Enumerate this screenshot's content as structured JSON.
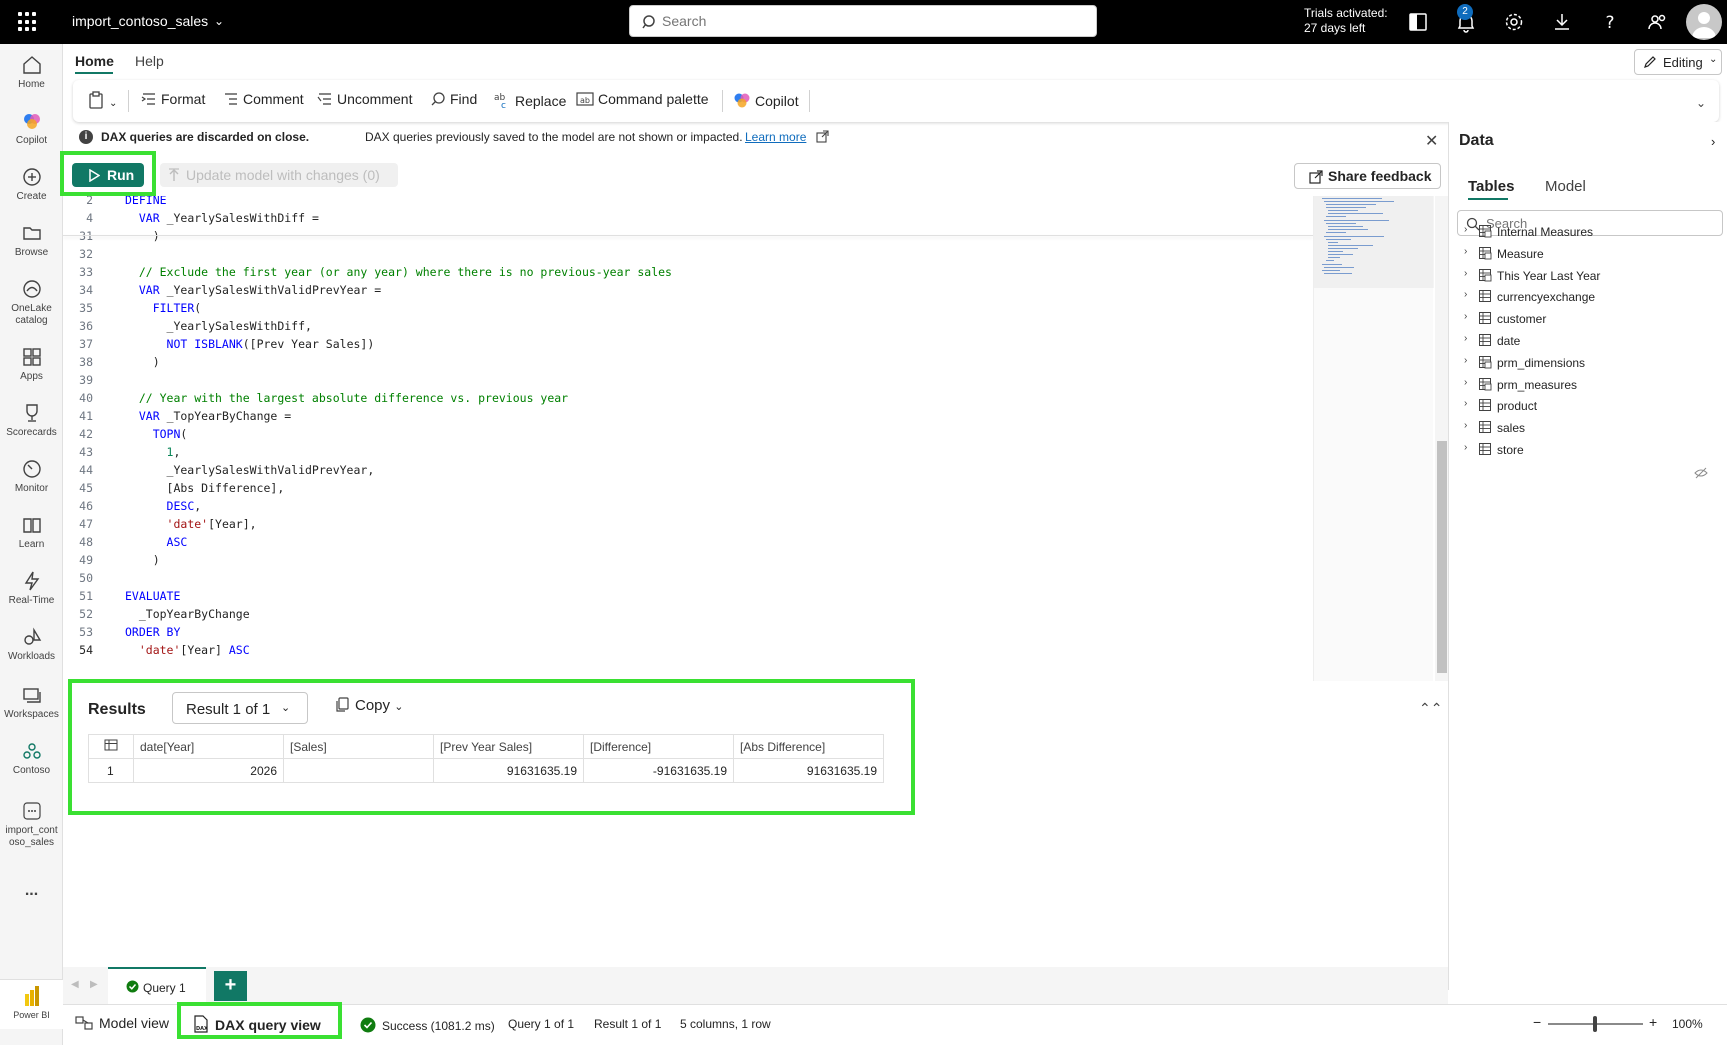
{
  "topbar": {
    "app_title": "import_contoso_sales",
    "search_placeholder": "Search",
    "trial_line1": "Trials activated:",
    "trial_line2": "27 days left",
    "notif_count": "2"
  },
  "rail": {
    "items": [
      {
        "label": "Home"
      },
      {
        "label": "Copilot"
      },
      {
        "label": "Create"
      },
      {
        "label": "Browse"
      },
      {
        "label": "OneLake catalog"
      },
      {
        "label": "Apps"
      },
      {
        "label": "Scorecards"
      },
      {
        "label": "Monitor"
      },
      {
        "label": "Learn"
      },
      {
        "label": "Real-Time"
      },
      {
        "label": "Workloads"
      },
      {
        "label": "Workspaces"
      },
      {
        "label": "Contoso"
      },
      {
        "label": "import_contoso_sales"
      }
    ],
    "more": "...",
    "product": "Power BI"
  },
  "ribbon": {
    "tabs": [
      "Home",
      "Help"
    ],
    "editing": "Editing",
    "toolbar": {
      "format": "Format",
      "comment": "Comment",
      "uncomment": "Uncomment",
      "find": "Find",
      "replace": "Replace",
      "command_palette": "Command palette",
      "copilot": "Copilot"
    }
  },
  "infobar": {
    "bold": "DAX queries are discarded on close.",
    "text": "DAX queries previously saved to the model are not shown or impacted.",
    "link": "Learn more"
  },
  "runbar": {
    "run": "Run",
    "update": "Update model with changes (0)",
    "feedback": "Share feedback"
  },
  "editor": {
    "lines": [
      {
        "n": "2",
        "segs": [
          {
            "c": "kw",
            "t": "DEFINE"
          }
        ]
      },
      {
        "n": "4",
        "segs": [
          {
            "c": "",
            "t": "  "
          },
          {
            "c": "kw",
            "t": "VAR"
          },
          {
            "c": "",
            "t": " _YearlySalesWithDiff ="
          }
        ]
      },
      {
        "n": "31",
        "segs": [
          {
            "c": "",
            "t": "    )"
          }
        ]
      },
      {
        "n": "32",
        "segs": [
          {
            "c": "",
            "t": ""
          }
        ]
      },
      {
        "n": "33",
        "segs": [
          {
            "c": "cm",
            "t": "  // Exclude the first year (or any year) where there is no previous-year sales"
          }
        ]
      },
      {
        "n": "34",
        "segs": [
          {
            "c": "",
            "t": "  "
          },
          {
            "c": "kw",
            "t": "VAR"
          },
          {
            "c": "",
            "t": " _YearlySalesWithValidPrevYear ="
          }
        ]
      },
      {
        "n": "35",
        "segs": [
          {
            "c": "",
            "t": "    "
          },
          {
            "c": "kw",
            "t": "FILTER"
          },
          {
            "c": "",
            "t": "("
          }
        ]
      },
      {
        "n": "36",
        "segs": [
          {
            "c": "",
            "t": "      _YearlySalesWithDiff,"
          }
        ]
      },
      {
        "n": "37",
        "segs": [
          {
            "c": "",
            "t": "      "
          },
          {
            "c": "kw",
            "t": "NOT ISBLANK"
          },
          {
            "c": "",
            "t": "([Prev Year Sales])"
          }
        ]
      },
      {
        "n": "38",
        "segs": [
          {
            "c": "",
            "t": "    )"
          }
        ]
      },
      {
        "n": "39",
        "segs": [
          {
            "c": "",
            "t": ""
          }
        ]
      },
      {
        "n": "40",
        "segs": [
          {
            "c": "cm",
            "t": "  // Year with the largest absolute difference vs. previous year"
          }
        ]
      },
      {
        "n": "41",
        "segs": [
          {
            "c": "",
            "t": "  "
          },
          {
            "c": "kw",
            "t": "VAR"
          },
          {
            "c": "",
            "t": " _TopYearByChange ="
          }
        ]
      },
      {
        "n": "42",
        "segs": [
          {
            "c": "",
            "t": "    "
          },
          {
            "c": "kw",
            "t": "TOPN"
          },
          {
            "c": "",
            "t": "("
          }
        ]
      },
      {
        "n": "43",
        "segs": [
          {
            "c": "",
            "t": "      "
          },
          {
            "c": "plain",
            "t": "1"
          },
          {
            "c": "",
            "t": ","
          }
        ]
      },
      {
        "n": "44",
        "segs": [
          {
            "c": "",
            "t": "      _YearlySalesWithValidPrevYear,"
          }
        ]
      },
      {
        "n": "45",
        "segs": [
          {
            "c": "",
            "t": "      [Abs Difference],"
          }
        ]
      },
      {
        "n": "46",
        "segs": [
          {
            "c": "",
            "t": "      "
          },
          {
            "c": "kw",
            "t": "DESC"
          },
          {
            "c": "",
            "t": ","
          }
        ]
      },
      {
        "n": "47",
        "segs": [
          {
            "c": "",
            "t": "      "
          },
          {
            "c": "st",
            "t": "'date'"
          },
          {
            "c": "",
            "t": "[Year],"
          }
        ]
      },
      {
        "n": "48",
        "segs": [
          {
            "c": "",
            "t": "      "
          },
          {
            "c": "kw",
            "t": "ASC"
          }
        ]
      },
      {
        "n": "49",
        "segs": [
          {
            "c": "",
            "t": "    )"
          }
        ]
      },
      {
        "n": "50",
        "segs": [
          {
            "c": "",
            "t": ""
          }
        ]
      },
      {
        "n": "51",
        "segs": [
          {
            "c": "kw",
            "t": "EVALUATE"
          }
        ]
      },
      {
        "n": "52",
        "segs": [
          {
            "c": "",
            "t": "  _TopYearByChange"
          }
        ]
      },
      {
        "n": "53",
        "segs": [
          {
            "c": "kw",
            "t": "ORDER BY"
          }
        ]
      },
      {
        "n": "54",
        "segs": [
          {
            "c": "",
            "t": "  "
          },
          {
            "c": "st",
            "t": "'date'"
          },
          {
            "c": "",
            "t": "[Year] "
          },
          {
            "c": "kw",
            "t": "ASC"
          }
        ]
      }
    ]
  },
  "results": {
    "title": "Results",
    "selector": "Result 1 of 1",
    "copy": "Copy",
    "columns": [
      "date[Year]",
      "[Sales]",
      "[Prev Year Sales]",
      "[Difference]",
      "[Abs Difference]"
    ],
    "rows": [
      [
        "1",
        "2026",
        "",
        "91631635.19",
        "-91631635.19",
        "91631635.19"
      ]
    ]
  },
  "data_pane": {
    "title": "Data",
    "tabs": [
      "Tables",
      "Model"
    ],
    "search_placeholder": "Search",
    "tables": [
      {
        "name": "Internal Measures",
        "icon": "measure-table-icon"
      },
      {
        "name": "Measure",
        "icon": "calc-table-icon"
      },
      {
        "name": "This Year Last Year",
        "icon": "measure-table-icon"
      },
      {
        "name": "currencyexchange",
        "icon": "table-icon"
      },
      {
        "name": "customer",
        "icon": "table-icon"
      },
      {
        "name": "date",
        "icon": "table-icon"
      },
      {
        "name": "prm_dimensions",
        "icon": "calc-table-icon"
      },
      {
        "name": "prm_measures",
        "icon": "calc-table-icon"
      },
      {
        "name": "product",
        "icon": "table-icon"
      },
      {
        "name": "sales",
        "icon": "table-icon"
      },
      {
        "name": "store",
        "icon": "table-icon"
      }
    ]
  },
  "query_tabs": {
    "tab1": "Query 1",
    "add": "+"
  },
  "statusbar": {
    "model_view": "Model view",
    "dax_view": "DAX query view",
    "success": "Success (1081.2 ms)",
    "query": "Query 1 of 1",
    "result": "Result 1 of 1",
    "cols": "5 columns, 1 row",
    "zoom": "100%"
  },
  "colors": {
    "accent": "#117865",
    "highlight": "#3ae032",
    "link": "#0f6cbd"
  }
}
